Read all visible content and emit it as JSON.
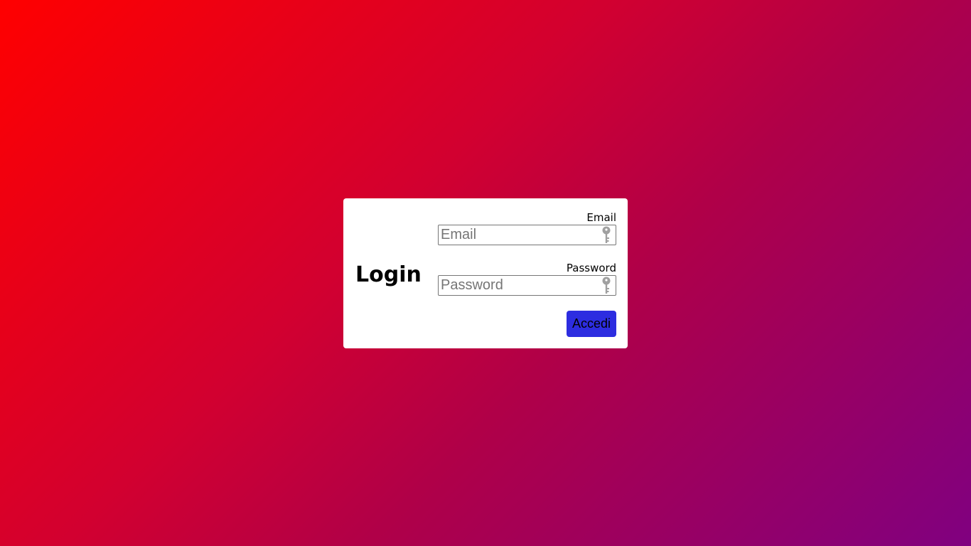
{
  "login_form": {
    "title": "Login",
    "email": {
      "label": "Email",
      "placeholder": "Email",
      "value": "",
      "icon": "key-icon"
    },
    "password": {
      "label": "Password",
      "placeholder": "Password",
      "value": "",
      "icon": "key-icon"
    },
    "submit_label": "Accedi"
  },
  "colors": {
    "background_start": "#ff0000",
    "background_end": "#800080",
    "card": "#ffffff",
    "button": "#2d2de0",
    "icon": "#a0a0a0"
  }
}
